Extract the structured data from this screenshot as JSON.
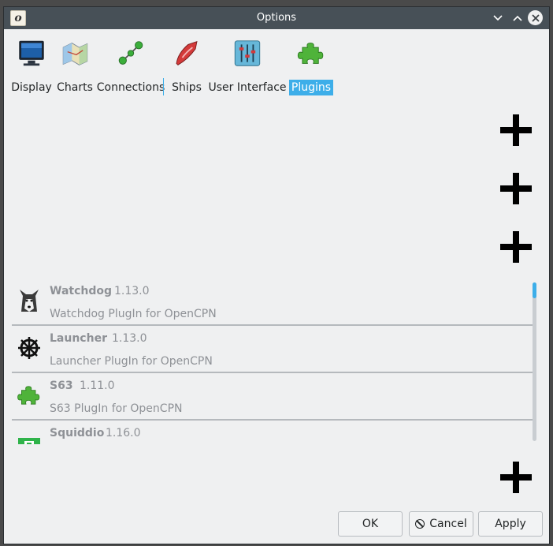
{
  "window": {
    "title": "Options",
    "app_icon_glyph": "o"
  },
  "toolbar": {
    "items": [
      {
        "label": "Display",
        "icon": "monitor-icon"
      },
      {
        "label": "Charts",
        "icon": "charts-icon"
      },
      {
        "label": "Connections",
        "icon": "connections-icon"
      },
      {
        "label": "Ships",
        "icon": "ship-icon"
      },
      {
        "label": "User Interface",
        "icon": "sliders-icon"
      },
      {
        "label": "Plugins",
        "icon": "puzzle-icon",
        "active": true
      }
    ]
  },
  "plugins": [
    {
      "name": "Watchdog",
      "version": "1.13.0",
      "description": "Watchdog PlugIn for OpenCPN",
      "icon": "husky-icon"
    },
    {
      "name": "Launcher",
      "version": "1.13.0",
      "description": "Launcher PlugIn for OpenCPN",
      "icon": "helm-wheel-icon"
    },
    {
      "name": "S63",
      "version": "1.11.0",
      "description": "S63 PlugIn for OpenCPN",
      "icon": "puzzle-icon"
    },
    {
      "name": "Squiddio",
      "version": "1.16.0",
      "description": "",
      "icon": "squiddio-icon"
    }
  ],
  "buttons": {
    "ok": "OK",
    "cancel": "Cancel",
    "apply": "Apply"
  },
  "colors": {
    "titlebar": "#475057",
    "accent": "#3daee9",
    "window_bg": "#eff0f1"
  }
}
